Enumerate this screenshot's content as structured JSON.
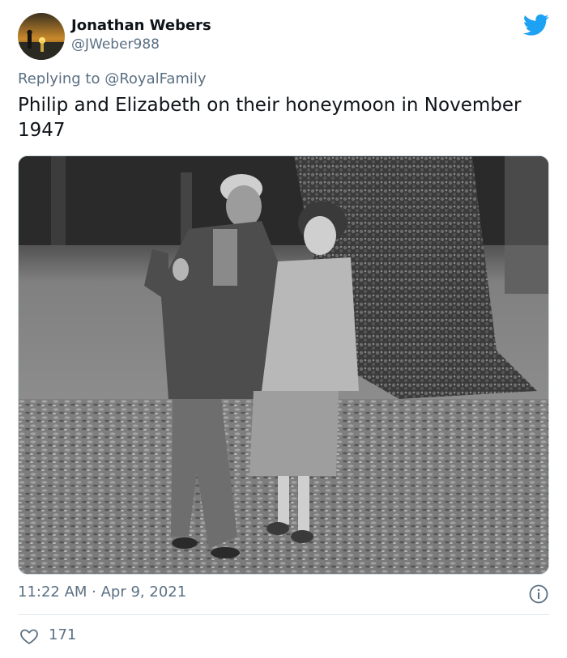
{
  "author": {
    "display_name": "Jonathan Webers",
    "handle": "@JWeber988",
    "avatar_icon": "sunset-avatar"
  },
  "reply": {
    "prefix": "Replying to",
    "mention": "@RoyalFamily"
  },
  "tweet": {
    "text": "Philip and Elizabeth on their honeymoon in November 1947",
    "timestamp": "11:22 AM · Apr 9, 2021"
  },
  "actions": {
    "like_count": "171"
  },
  "icons": {
    "brand": "twitter-bird-icon",
    "info": "info-icon",
    "like": "heart-icon"
  },
  "colors": {
    "brand": "#1da1f2",
    "secondary_text": "#5b7083",
    "primary_text": "#0f1419",
    "divider": "#e1e8ed"
  }
}
